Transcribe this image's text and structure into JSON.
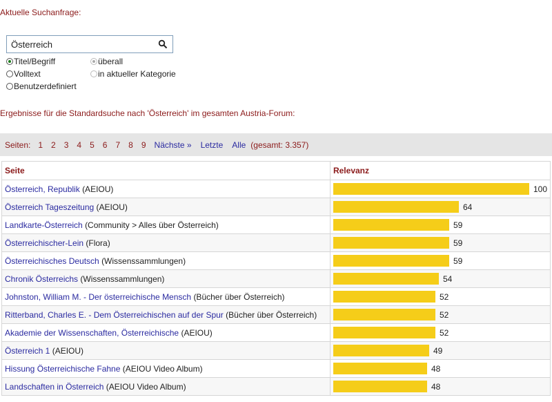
{
  "search": {
    "heading": "Aktuelle Suchanfrage:",
    "query": "Österreich",
    "options_type": [
      {
        "label": "Titel/Begriff",
        "checked": true
      },
      {
        "label": "Volltext",
        "checked": false
      },
      {
        "label": "Benutzerdefiniert",
        "checked": false
      }
    ],
    "options_scope": [
      {
        "label": "überall",
        "checked": true
      },
      {
        "label": "in aktueller Kategorie",
        "checked": false
      }
    ]
  },
  "results_note": "Ergebnisse für die Standardsuche nach 'Österreich' im gesamten Austria-Forum:",
  "pager": {
    "label": "Seiten:",
    "pages": [
      "1",
      "2",
      "3",
      "4",
      "5",
      "6",
      "7",
      "8",
      "9"
    ],
    "next": "Nächste »",
    "last": "Letzte",
    "all": "Alle",
    "total": "(gesamt: 3.357)"
  },
  "table": {
    "col_page": "Seite",
    "col_relevance": "Relevanz",
    "bar_color": "#f5cd19",
    "rows": [
      {
        "title": "Österreich, Republik",
        "category": "(AEIOU)",
        "relevance": 100
      },
      {
        "title": "Österreich Tageszeitung",
        "category": "(AEIOU)",
        "relevance": 64
      },
      {
        "title": "Landkarte-Österreich",
        "category": "(Community > Alles über Österreich)",
        "relevance": 59
      },
      {
        "title": "Österreichischer-Lein",
        "category": "(Flora)",
        "relevance": 59
      },
      {
        "title": "Österreichisches Deutsch",
        "category": "(Wissenssammlungen)",
        "relevance": 59
      },
      {
        "title": "Chronik Österreichs",
        "category": "(Wissenssammlungen)",
        "relevance": 54
      },
      {
        "title": "Johnston, William M. - Der österreichische Mensch",
        "category": "(Bücher über Österreich)",
        "relevance": 52
      },
      {
        "title": "Ritterband, Charles E. - Dem Österreichischen auf der Spur",
        "category": "(Bücher über Österreich)",
        "relevance": 52
      },
      {
        "title": "Akademie der Wissenschaften, Österreichische",
        "category": "(AEIOU)",
        "relevance": 52
      },
      {
        "title": "Österreich 1",
        "category": "(AEIOU)",
        "relevance": 49
      },
      {
        "title": "Hissung Österreichische Fahne",
        "category": "(AEIOU Video Album)",
        "relevance": 48
      },
      {
        "title": "Landschaften in Österreich",
        "category": "(AEIOU Video Album)",
        "relevance": 48
      }
    ]
  }
}
